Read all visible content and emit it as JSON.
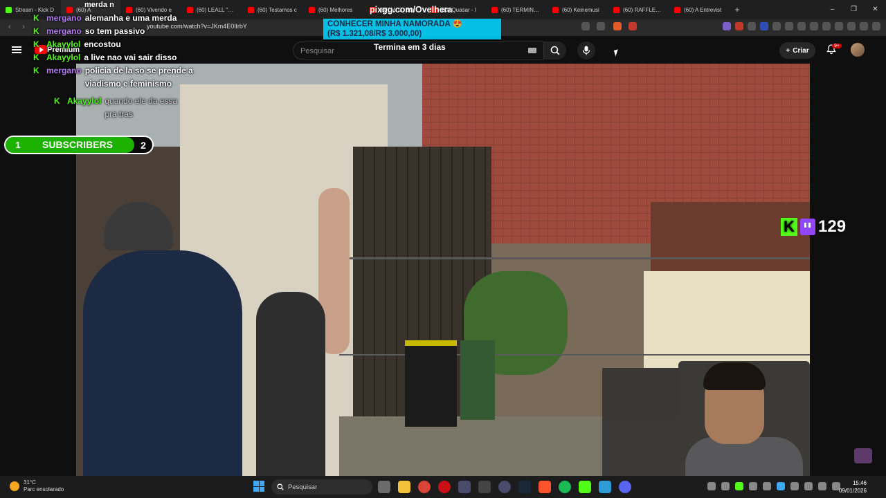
{
  "browser": {
    "tabs": [
      {
        "label": "Stream - Kick D",
        "icon": "kick-icon",
        "color": "#53fc18"
      },
      {
        "label": "(60) A",
        "icon": "youtube-icon",
        "color": "#ff0000",
        "active": true
      },
      {
        "label": "(60) Vivendo e",
        "icon": "youtube-icon",
        "color": "#ff0000"
      },
      {
        "label": "(60) LEALL \"Faç",
        "icon": "youtube-icon",
        "color": "#ff0000"
      },
      {
        "label": "(60) Testamos c",
        "icon": "youtube-icon",
        "color": "#ff0000"
      },
      {
        "label": "(60) Melhores",
        "icon": "youtube-icon",
        "color": "#ff0000"
      },
      {
        "label": "(60) M. C. Bax",
        "icon": "youtube-icon",
        "color": "#ff0000"
      },
      {
        "label": "(60) Quasar - I",
        "icon": "youtube-icon",
        "color": "#ff0000"
      },
      {
        "label": "(60) TERMINAN",
        "icon": "youtube-icon",
        "color": "#ff0000"
      },
      {
        "label": "(60) Keinemusi",
        "icon": "youtube-icon",
        "color": "#ff0000"
      },
      {
        "label": "(60) RAFFLES D",
        "icon": "youtube-icon",
        "color": "#ff0000"
      },
      {
        "label": "(60) A Entrevist",
        "icon": "youtube-icon",
        "color": "#ff0000"
      }
    ],
    "url": "youtube.com/watch?v=JKm4E0lIrbY",
    "new_tab": "+",
    "window_controls": [
      "–",
      "❐",
      "✕"
    ]
  },
  "youtube": {
    "premium_label": "Premium",
    "search_placeholder": "Pesquisar",
    "create_label": "Criar",
    "notifications_badge": "9+"
  },
  "overlay": {
    "pixgg": "pixgg.com/Ovelhera",
    "promo_line1": "CONHECER MINHA NAMORADA 😍",
    "promo_line2": "(R$ 1.321,08/R$ 3.000,00)",
    "countdown": "Termina em 3 dias",
    "subs": {
      "left": "1",
      "label": "SUBSCRIBERS",
      "right": "2"
    },
    "viewers": "129",
    "chat_top_fragment": "merda n"
  },
  "chat": [
    {
      "user": "mergano",
      "user_color": "#b57cf0",
      "message": "alemanha e uma merda"
    },
    {
      "user": "mergano",
      "user_color": "#b57cf0",
      "message": "so tem passivo"
    },
    {
      "user": "Akayylol",
      "user_color": "#53fc18",
      "message": "encostou"
    },
    {
      "user": "Akayylol",
      "user_color": "#53fc18",
      "message": "a live nao vai sair disso"
    },
    {
      "user": "mergano",
      "user_color": "#b57cf0",
      "message": "policia de la so se prende a viadismo e feminismo"
    },
    {
      "user": "Akayylol",
      "user_color": "#53fc18",
      "message": "quando ele da essa pra tras",
      "dim": true
    }
  ],
  "taskbar": {
    "weather_temp": "31°C",
    "weather_desc": "Parc ensolarado",
    "search_label": "Pesquisar",
    "time": "15:46",
    "date": "09/01/2026"
  }
}
